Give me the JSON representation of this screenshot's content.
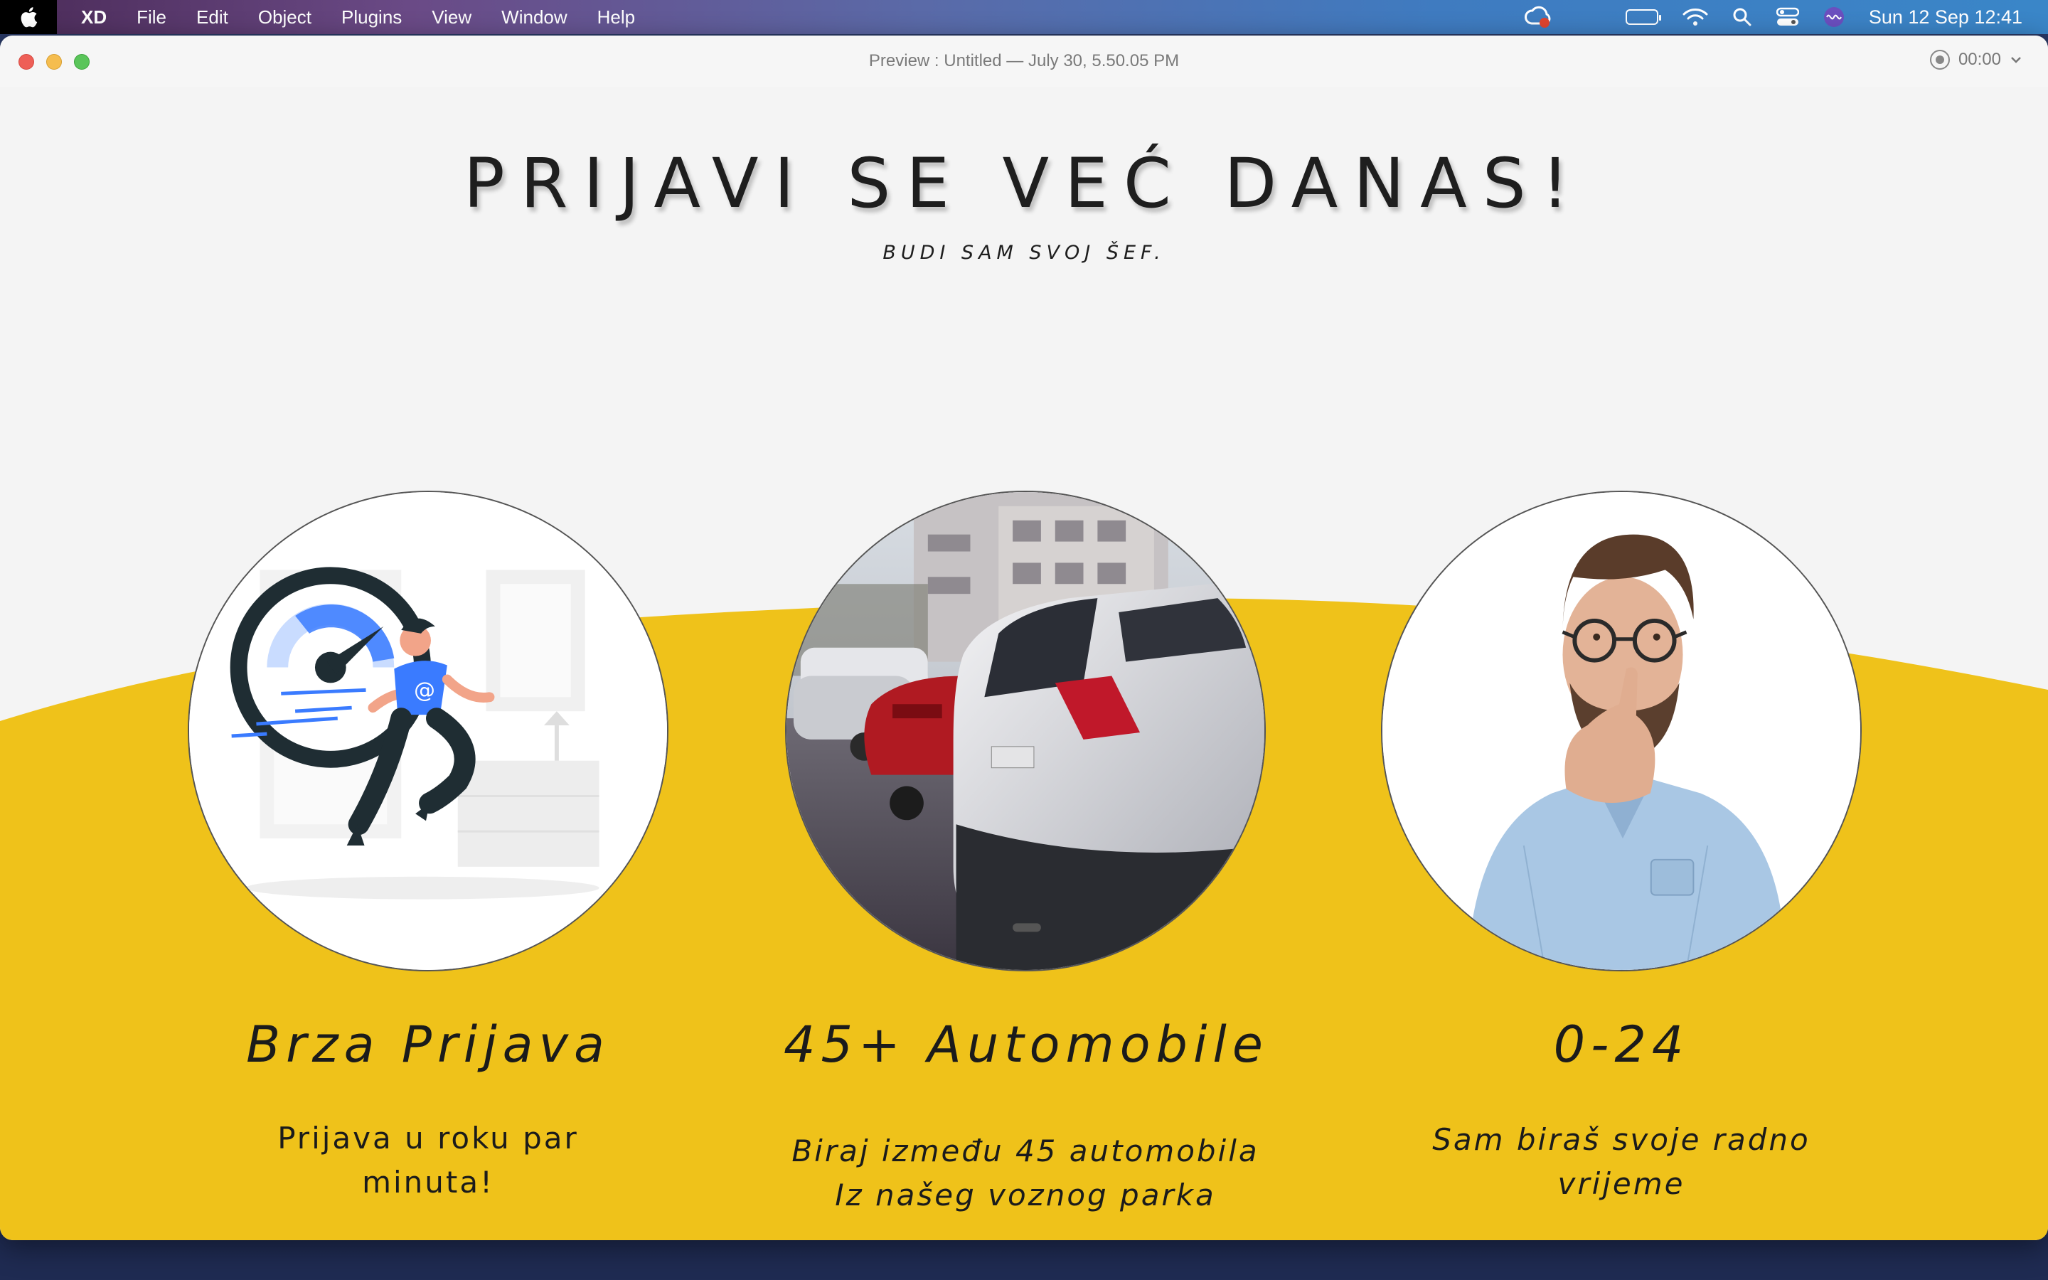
{
  "menubar": {
    "app_name": "XD",
    "items": [
      "File",
      "Edit",
      "Object",
      "Plugins",
      "View",
      "Window",
      "Help"
    ],
    "clock": "Sun 12 Sep  12:41",
    "status_icons": [
      "creative-cloud-icon",
      "croatia-flag-icon",
      "battery-icon",
      "wifi-icon",
      "search-icon",
      "control-center-icon",
      "siri-icon"
    ]
  },
  "window": {
    "title": "Preview : Untitled — July 30, 5.50.05 PM",
    "recording_time": "00:00"
  },
  "hero": {
    "title": "PRIJAVI SE VEĆ DANAS!",
    "subtitle": "BUDI SAM SVOJ ŠEF."
  },
  "features": [
    {
      "title": "Brza Prijava",
      "text_lines": [
        "Prijava u roku par",
        "minuta!"
      ],
      "image": "running-man-speedometer-illustration"
    },
    {
      "title": "45+ Automobile",
      "text_lines": [
        "Biraj između 45 automobila",
        "Iz našeg voznog parka"
      ],
      "image": "parked-cars-photo"
    },
    {
      "title": "0-24",
      "text_lines": [
        "Sam biraš svoje radno",
        "vrijeme"
      ],
      "image": "thinking-man-photo"
    }
  ],
  "colors": {
    "accent_yellow": "#efc21a",
    "background": "#f4f4f4",
    "text": "#1b1b1b"
  }
}
